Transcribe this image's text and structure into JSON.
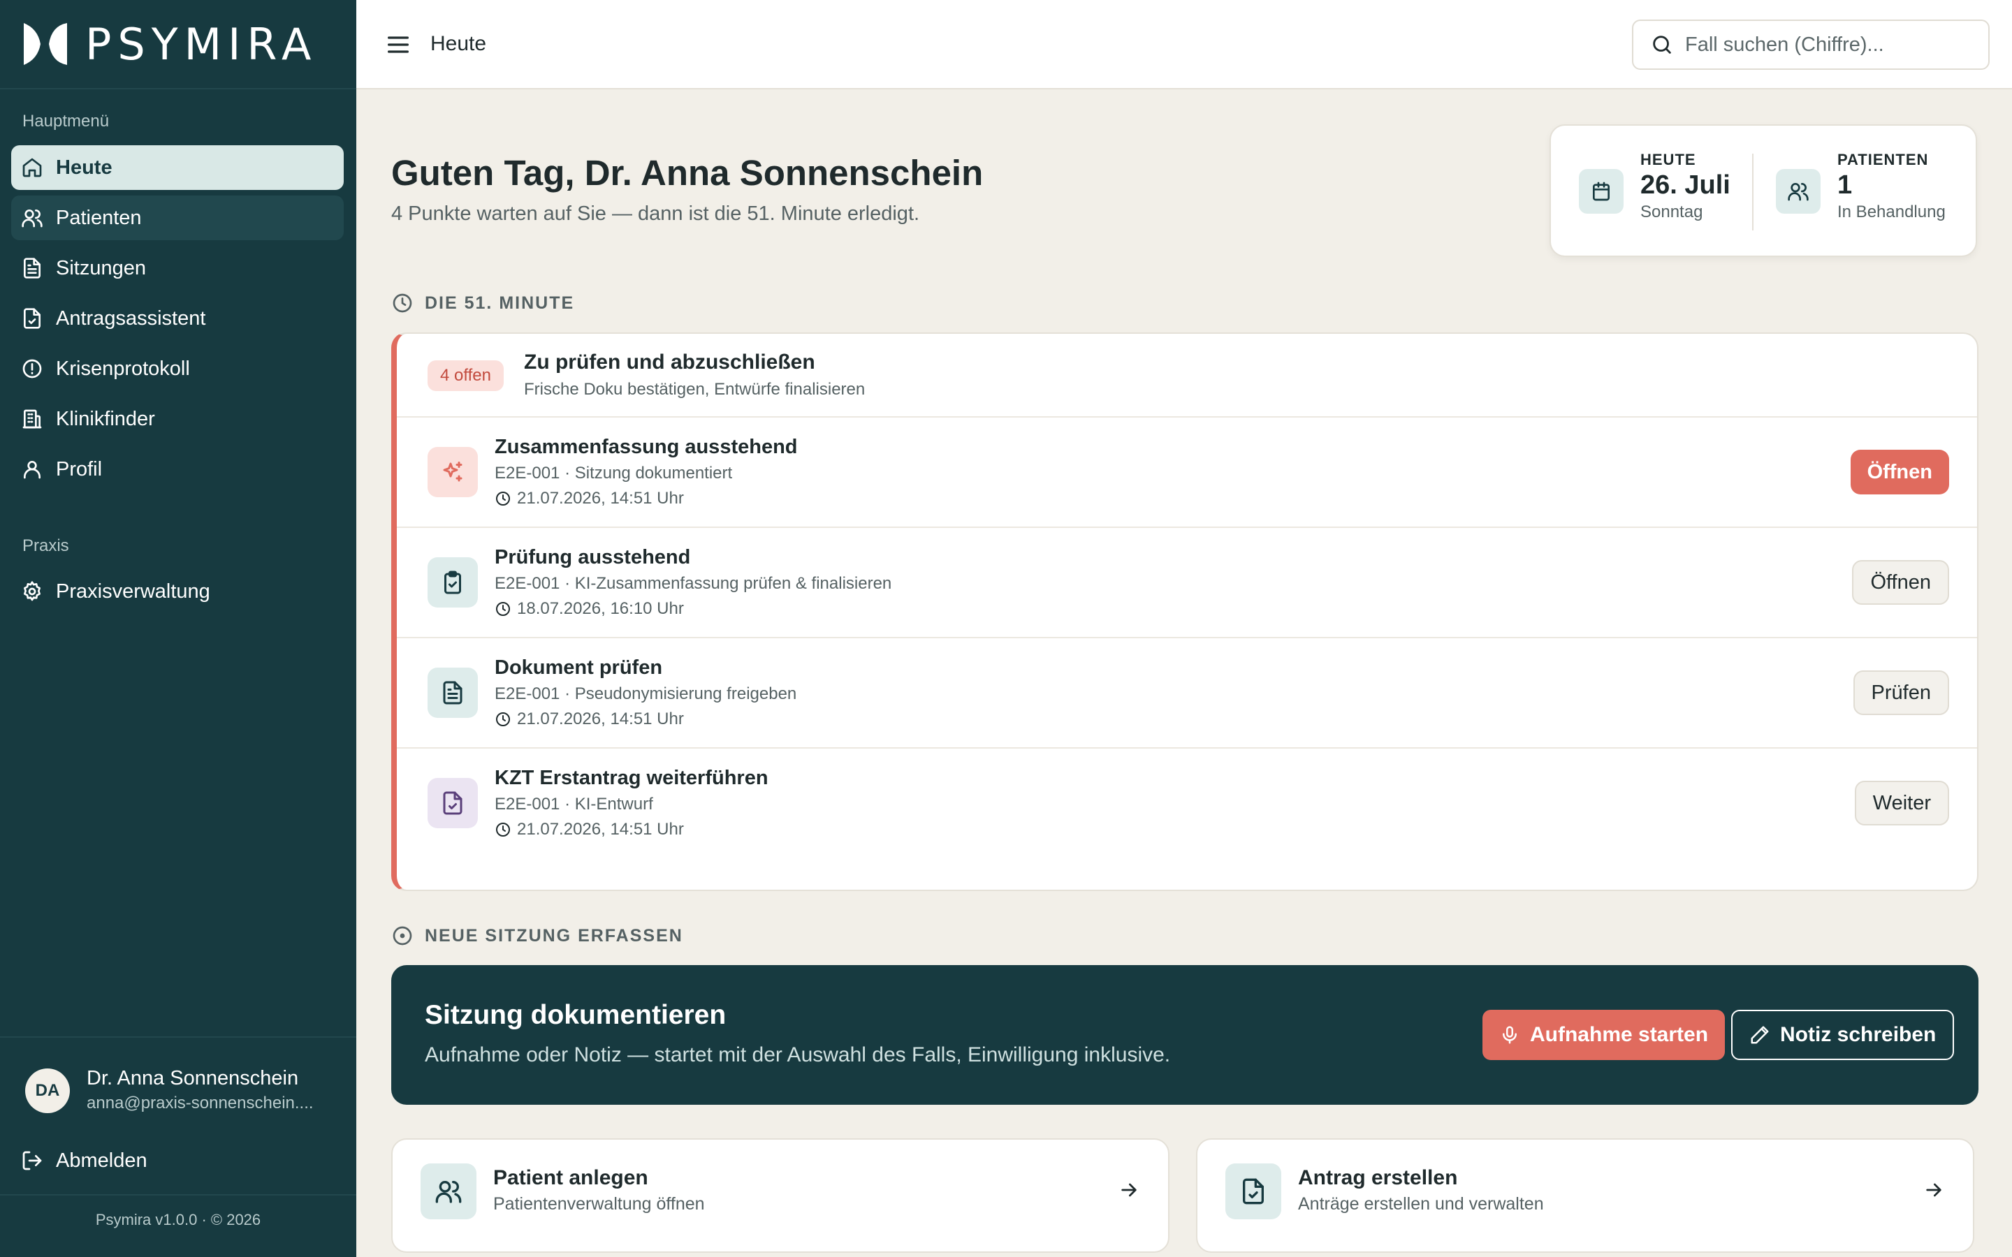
{
  "brand": {
    "name": "PSYMIRA"
  },
  "sidebar": {
    "main_section_title": "Hauptmenü",
    "items": [
      {
        "label": "Heute",
        "icon": "home-icon"
      },
      {
        "label": "Patienten",
        "icon": "users-icon"
      },
      {
        "label": "Sitzungen",
        "icon": "document-icon"
      },
      {
        "label": "Antragsassistent",
        "icon": "file-check-icon"
      },
      {
        "label": "Krisenprotokoll",
        "icon": "alert-circle-icon"
      },
      {
        "label": "Klinikfinder",
        "icon": "building-icon"
      },
      {
        "label": "Profil",
        "icon": "user-icon"
      }
    ],
    "practice_section_title": "Praxis",
    "practice_items": [
      {
        "label": "Praxisverwaltung",
        "icon": "gear-icon"
      }
    ],
    "user": {
      "initials": "DA",
      "name": "Dr. Anna Sonnenschein",
      "email": "anna@praxis-sonnenschein...."
    },
    "logout_label": "Abmelden",
    "version": "Psymira v1.0.0 · © 2026"
  },
  "topbar": {
    "title": "Heute",
    "search_placeholder": "Fall suchen (Chiffre)..."
  },
  "greeting": {
    "title": "Guten Tag, Dr. Anna Sonnenschein",
    "subtitle": "4 Punkte warten auf Sie — dann ist die 51. Minute erledigt."
  },
  "stats": {
    "today_label": "HEUTE",
    "today_value": "26. Juli",
    "today_sub": "Sonntag",
    "patients_label": "PATIENTEN",
    "patients_value": "1",
    "patients_sub": "In Behandlung"
  },
  "minute_section": {
    "title": "DIE 51. MINUTE",
    "badge": "4 offen",
    "head_title": "Zu prüfen und abzuschließen",
    "head_sub": "Frische Doku bestätigen, Entwürfe finalisieren",
    "tasks": [
      {
        "title": "Zusammenfassung ausstehend",
        "meta": "E2E-001 · Sitzung dokumentiert",
        "time": "21.07.2026, 14:51 Uhr",
        "button": "Öffnen",
        "icon": "sparkles-icon",
        "color": "#fbe0dc"
      },
      {
        "title": "Prüfung ausstehend",
        "meta": "E2E-001 · KI-Zusammenfassung prüfen & finalisieren",
        "time": "18.07.2026, 16:10 Uhr",
        "button": "Öffnen",
        "icon": "clipboard-check-icon",
        "color": "#deeceb"
      },
      {
        "title": "Dokument prüfen",
        "meta": "E2E-001 · Pseudonymisierung freigeben",
        "time": "21.07.2026, 14:51 Uhr",
        "button": "Prüfen",
        "icon": "document-icon",
        "color": "#deeceb"
      },
      {
        "title": "KZT Erstantrag weiterführen",
        "meta": "E2E-001 · KI-Entwurf",
        "time": "21.07.2026, 14:51 Uhr",
        "button": "Weiter",
        "icon": "file-check-icon",
        "color": "#ebe4f2"
      }
    ]
  },
  "session_section": {
    "title": "NEUE SITZUNG ERFASSEN",
    "banner_title": "Sitzung dokumentieren",
    "banner_sub": "Aufnahme oder Notiz — startet mit der Auswahl des Falls, Einwilligung inklusive.",
    "record_label": "Aufnahme starten",
    "note_label": "Notiz schreiben"
  },
  "quick_actions": [
    {
      "title": "Patient anlegen",
      "sub": "Patientenverwaltung öffnen",
      "icon": "users-icon"
    },
    {
      "title": "Antrag erstellen",
      "sub": "Anträge erstellen und verwalten",
      "icon": "file-check-icon"
    }
  ],
  "colors": {
    "sidebar_bg": "#173a40",
    "accent": "#e06b5e",
    "page_bg": "#f2efe8",
    "active_nav_bg": "#d9e8e6"
  }
}
